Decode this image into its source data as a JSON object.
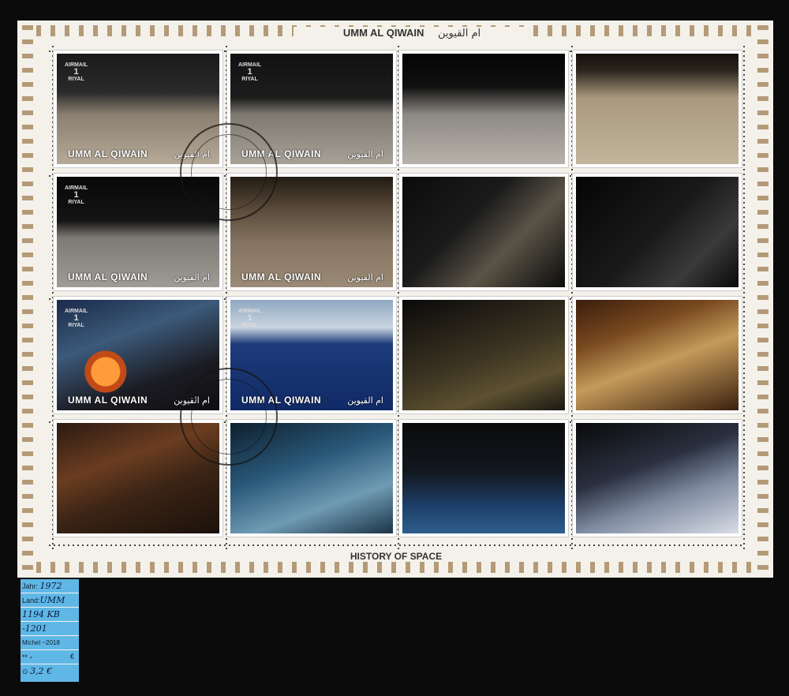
{
  "sheet": {
    "title_latin": "UMM AL QIWAIN",
    "title_arabic": "ام القيوين",
    "footer": "HISTORY OF SPACE"
  },
  "stamp_text": {
    "airmail": "AIRMAIL",
    "value": "1",
    "currency": "RIYAL",
    "country": "UMM AL QIWAIN",
    "country_arabic": "ام القيوين"
  },
  "stamps": [
    {
      "scene": "lunar-module-and-rover",
      "show_airmail": true,
      "show_country": true
    },
    {
      "scene": "astronaut-with-rover",
      "show_airmail": true,
      "show_country": true
    },
    {
      "scene": "lunar-module-flag",
      "show_airmail": false,
      "show_country": false
    },
    {
      "scene": "astronaut-on-moon",
      "show_airmail": false,
      "show_country": false
    },
    {
      "scene": "lunar-rover",
      "show_airmail": true,
      "show_country": true
    },
    {
      "scene": "astronaut-walking",
      "show_airmail": false,
      "show_country": true
    },
    {
      "scene": "moon-rock-closeup",
      "show_airmail": false,
      "show_country": false
    },
    {
      "scene": "spacecraft-in-orbit",
      "show_airmail": false,
      "show_country": false
    },
    {
      "scene": "capsule-reentry",
      "show_airmail": true,
      "show_country": true
    },
    {
      "scene": "ocean-recovery-carrier",
      "show_airmail": true,
      "show_country": true
    },
    {
      "scene": "apollo-soyuz-docking",
      "show_airmail": false,
      "show_country": false
    },
    {
      "scene": "spacecraft-engines",
      "show_airmail": false,
      "show_country": false
    },
    {
      "scene": "spacewalk-detail",
      "show_airmail": false,
      "show_country": false
    },
    {
      "scene": "astronauts-spacewalk",
      "show_airmail": false,
      "show_country": false
    },
    {
      "scene": "space-station",
      "show_airmail": false,
      "show_country": false
    },
    {
      "scene": "space-shuttle",
      "show_airmail": false,
      "show_country": false
    }
  ],
  "label_card": {
    "year_label": "Jahr:",
    "year_value": "1972",
    "country_label": "Land:",
    "country_value": "UMM",
    "catalog_value": "1194 KB",
    "catalog_value_2": "-1201",
    "michel_label": "Michel ~2018",
    "mint_symbol": "**",
    "mint_value": "-",
    "mint_currency": "€",
    "used_symbol": "⊙",
    "used_value": "3,2 €"
  }
}
